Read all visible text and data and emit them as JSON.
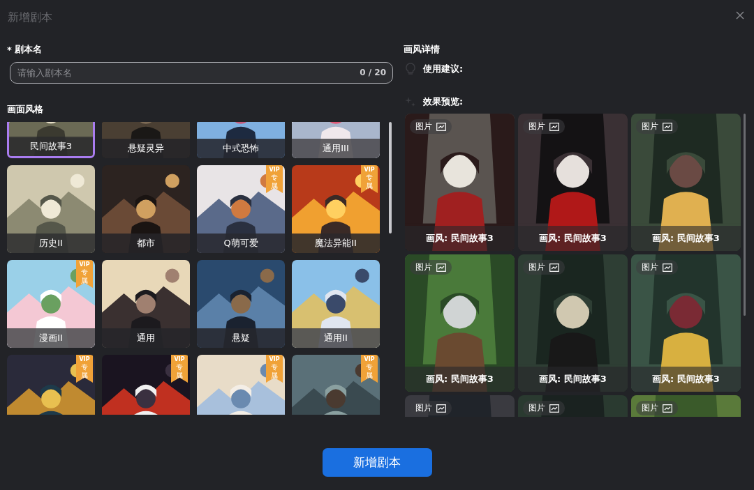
{
  "dialog": {
    "title": "新增剧本"
  },
  "name_field": {
    "required_mark": "*",
    "label": "剧本名",
    "placeholder": "请输入剧本名",
    "counter": "0 / 20"
  },
  "style_section": {
    "title": "画面风格",
    "styles": [
      {
        "label": "民间故事3",
        "selected": true
      },
      {
        "label": "悬疑灵异",
        "selected": false
      },
      {
        "label": "中式恐怖",
        "selected": false
      },
      {
        "label": "通用III",
        "selected": false
      },
      {
        "label": "历史II",
        "selected": false
      },
      {
        "label": "都市",
        "selected": false
      },
      {
        "label": "Q萌可爱",
        "selected": false,
        "badge": [
          "VIP",
          "专属"
        ]
      },
      {
        "label": "魔法异能II",
        "selected": false,
        "badge": [
          "VIP",
          "专属"
        ]
      },
      {
        "label": "漫画II",
        "selected": false,
        "badge": [
          "VIP",
          "专属"
        ]
      },
      {
        "label": "通用",
        "selected": false
      },
      {
        "label": "悬疑",
        "selected": false
      },
      {
        "label": "通用II",
        "selected": false
      },
      {
        "selected": false,
        "badge": [
          "VIP",
          "专属"
        ]
      },
      {
        "selected": false,
        "badge": [
          "VIP",
          "专属"
        ]
      },
      {
        "selected": false,
        "badge": [
          "VIP",
          "专属"
        ]
      },
      {
        "selected": false,
        "badge": [
          "VIP",
          "专属"
        ]
      }
    ]
  },
  "detail": {
    "title": "画风详情",
    "usage_label": "使用建议:",
    "preview_label": "效果预览:",
    "previews": [
      {
        "badge": "图片",
        "caption": "画风: 民间故事3"
      },
      {
        "badge": "图片",
        "caption": "画风: 民间故事3"
      },
      {
        "badge": "图片",
        "caption": "画风: 民间故事3"
      },
      {
        "badge": "图片",
        "caption": "画风: 民间故事3"
      },
      {
        "badge": "图片",
        "caption": "画风: 民间故事3"
      },
      {
        "badge": "图片",
        "caption": "画风: 民间故事3"
      },
      {
        "badge": "图片"
      },
      {
        "badge": "图片"
      },
      {
        "badge": "图片"
      }
    ]
  },
  "submit_button": "新增剧本"
}
